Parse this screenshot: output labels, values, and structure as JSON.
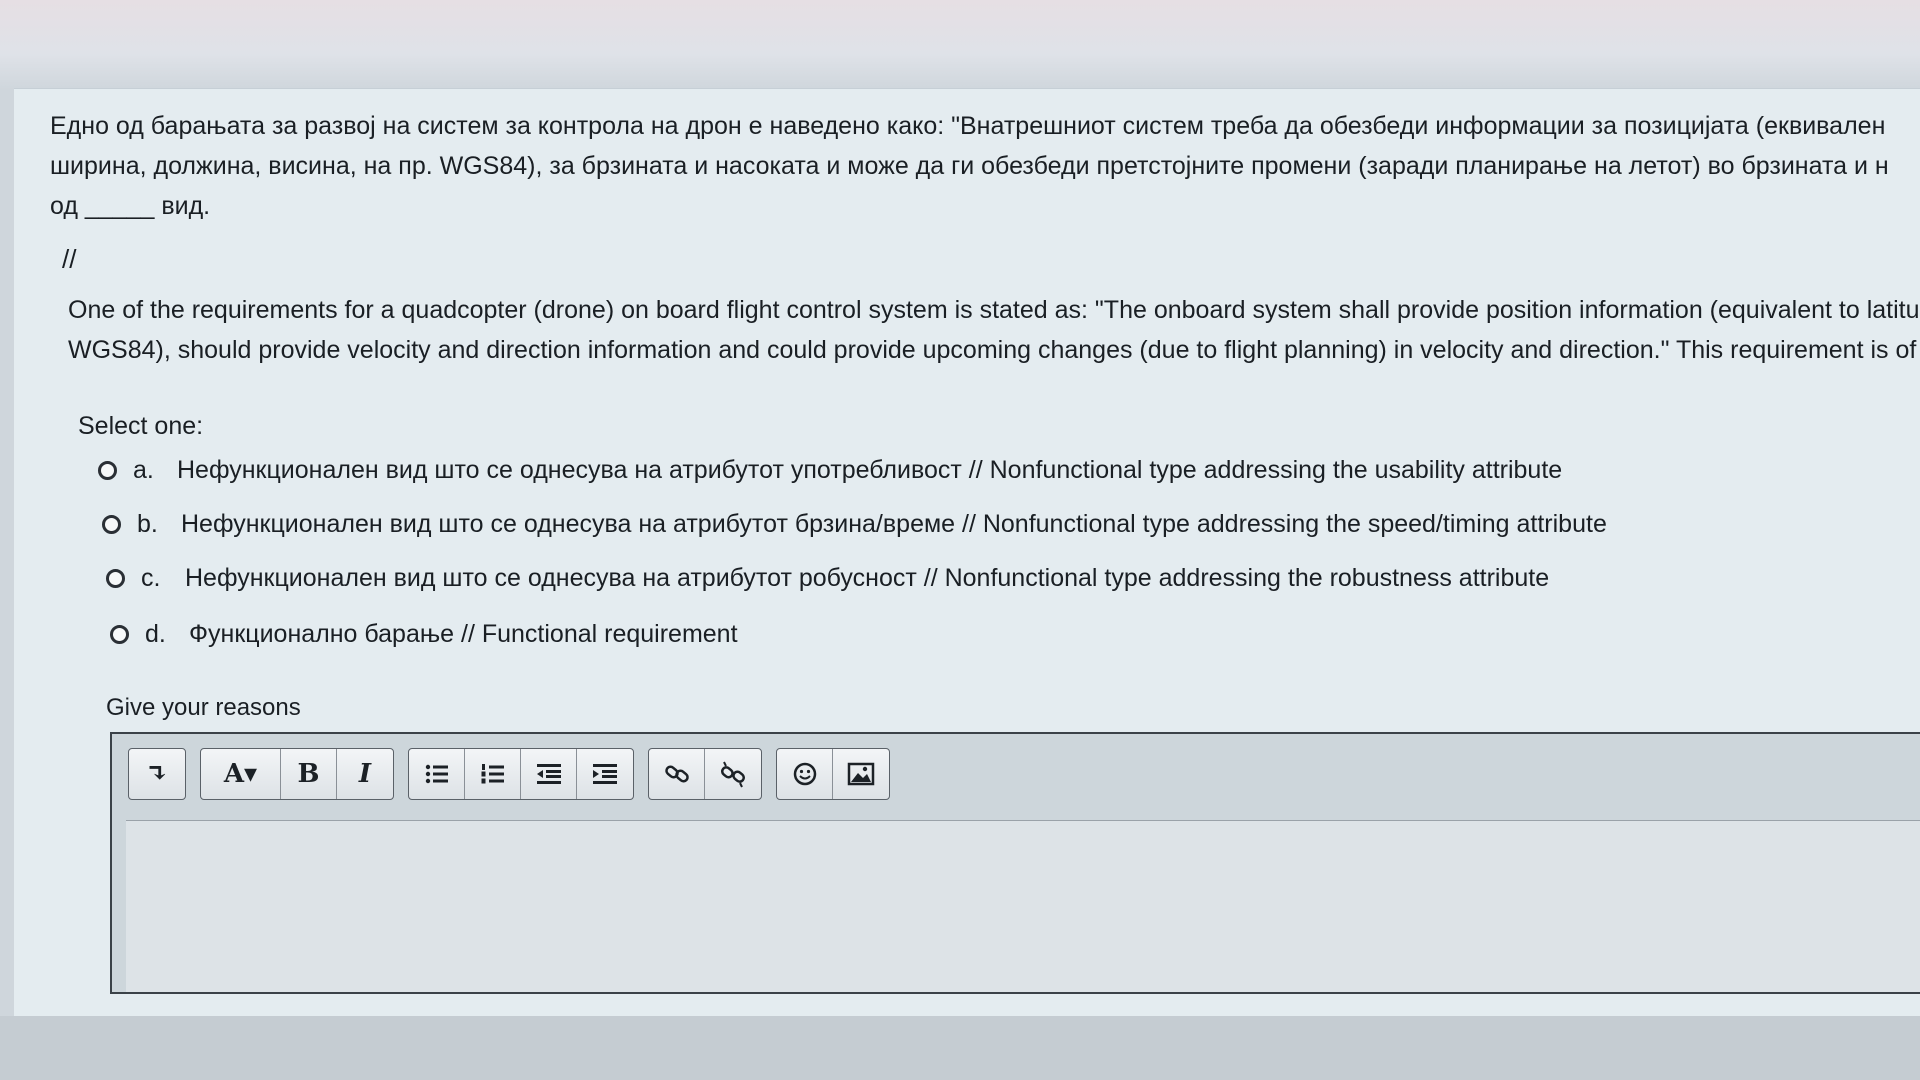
{
  "question": {
    "mk_lines": [
      "Едно од барањата за развој на систем за контрола на дрон е наведено како: \"Внатрешниот систем треба да обезбеди информации за позицијата (еквивален",
      "ширина, должина, висина, на пр. WGS84), за брзината и насоката и може да ги обезбеди претстојните промени (заради планирање на летот) во брзината и н",
      "од _____ вид."
    ],
    "separator": "//",
    "en_lines": [
      "One of the requirements for a quadcopter (drone) on board flight control system is stated as: \"The onboard system shall provide position information (equivalent to latitu",
      "WGS84), should provide velocity and direction information and could provide upcoming changes (due to flight planning) in velocity and direction.\" This requirement is of"
    ]
  },
  "select_label": "Select one:",
  "options": [
    {
      "letter": "a.",
      "text": "Нефункционален вид што се однесува на атрибутот употребливост // Nonfunctional type addressing the usability attribute"
    },
    {
      "letter": "b.",
      "text": "Нефункционален вид што се однесува на атрибутот брзина/време // Nonfunctional type addressing the speed/timing attribute"
    },
    {
      "letter": "c.",
      "text": "Нефункционален вид што се однесува на атрибутот робусност // Nonfunctional type addressing the robustness attribute"
    },
    {
      "letter": "d.",
      "text": "Функционално барање // Functional requirement"
    }
  ],
  "reasons_label": "Give your reasons",
  "toolbar": {
    "expand": "↴",
    "font": "A▾",
    "bold": "B",
    "italic": "I",
    "icons": [
      "expand-icon",
      "font-color-icon",
      "bold-icon",
      "italic-icon",
      "bullet-list-icon",
      "numbered-list-icon",
      "outdent-icon",
      "indent-icon",
      "link-icon",
      "unlink-icon",
      "emoji-icon",
      "image-icon"
    ]
  }
}
